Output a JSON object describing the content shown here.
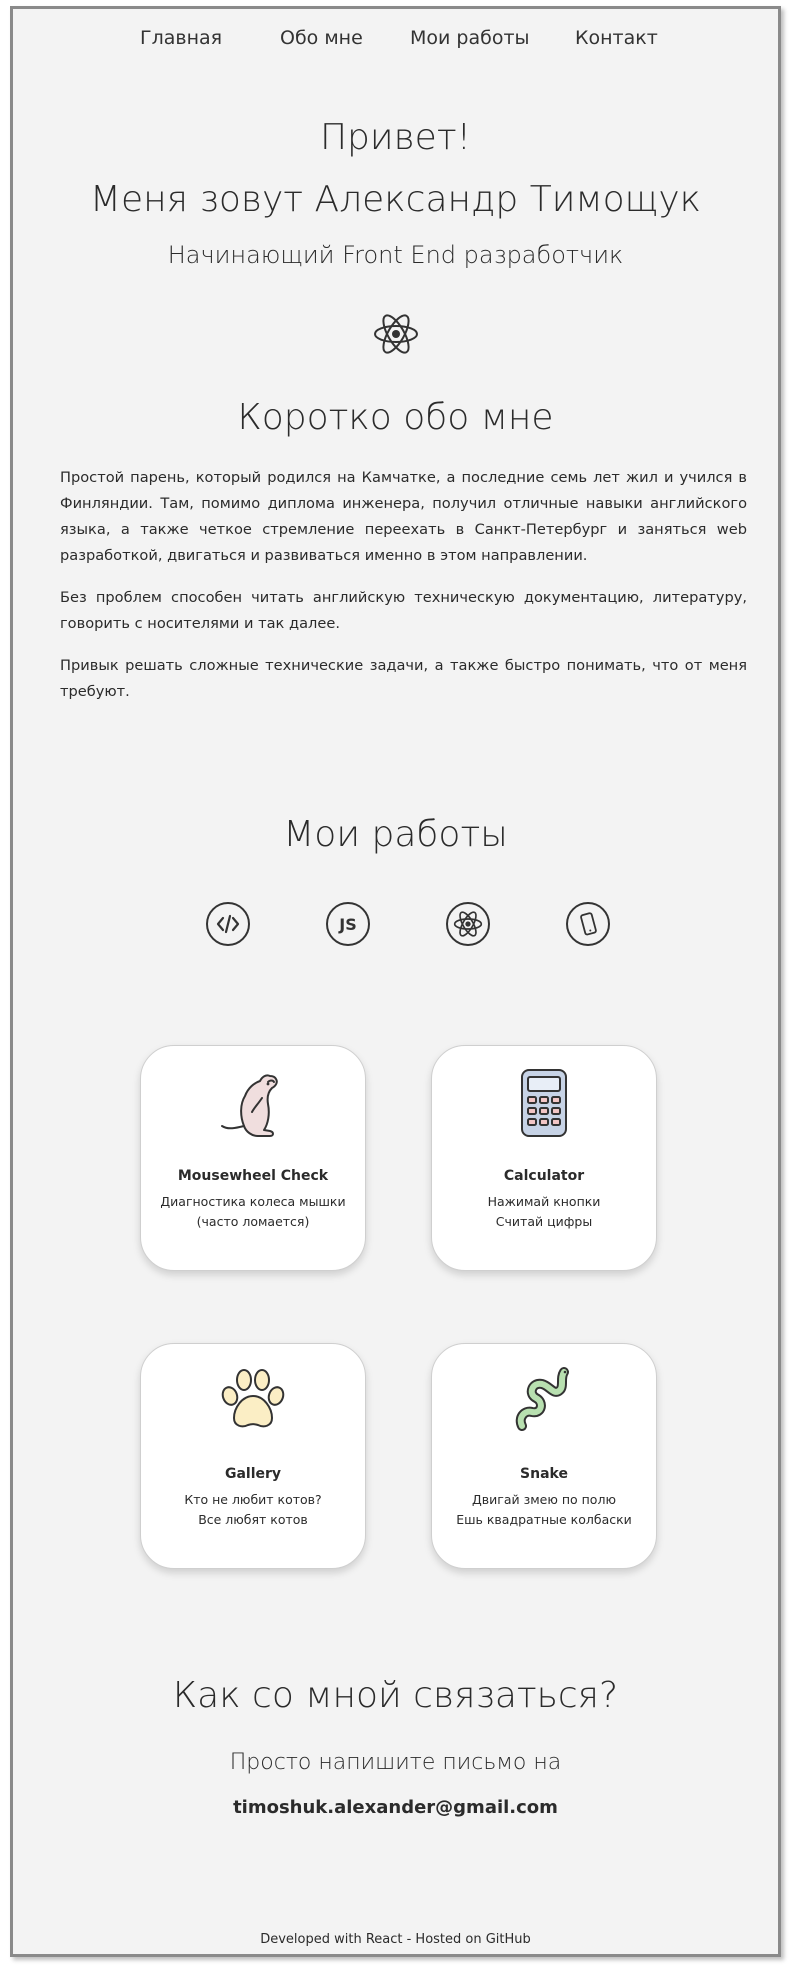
{
  "nav": {
    "home": "Главная",
    "about": "Обо мне",
    "works": "Мои работы",
    "contact": "Контакт"
  },
  "hero": {
    "greeting": "Привет!",
    "name": "Меня зовут Александр Тимощук",
    "subtitle": "Начинающий Front End разработчик",
    "icon": "react-atom-icon"
  },
  "about": {
    "title": "Коротко обо мне",
    "paragraphs": [
      "Простой парень, который родился на Камчатке, а последние семь лет жил и учился в Финляндии. Там, помимо диплома инженера, получил отличные навыки английского языка, а также четкое стремление переехать в Санкт-Петербург и заняться web разработкой, двигаться и развиваться именно в этом направлении.",
      "Без проблем способен читать английскую техническую документацию, литературу, говорить с носителями и так далее.",
      "Привык решать сложные технические задачи, а также быстро понимать, что от меня требуют."
    ]
  },
  "works": {
    "title": "Мои работы",
    "tech_icons": [
      "html-code-icon",
      "js-icon",
      "react-atom-icon",
      "mobile-phone-icon"
    ],
    "projects": [
      {
        "title": "Mousewheel Check",
        "desc_line1": "Диагностика колеса мышки",
        "desc_line2": "(часто ломается)",
        "icon": "mouse-icon"
      },
      {
        "title": "Calculator",
        "desc_line1": "Нажимай кнопки",
        "desc_line2": "Считай цифры",
        "icon": "calculator-icon"
      },
      {
        "title": "Gallery",
        "desc_line1": "Кто не любит котов?",
        "desc_line2": "Все любят котов",
        "icon": "paw-icon"
      },
      {
        "title": "Snake",
        "desc_line1": "Двигай змею по полю",
        "desc_line2": "Ешь квадратные колбаски",
        "icon": "snake-icon"
      }
    ]
  },
  "contact": {
    "title": "Как со мной связаться?",
    "text": "Просто напишите письмо на",
    "email": "timoshuk.alexander@gmail.com"
  },
  "footer": {
    "text": "Developed with React - Hosted on GitHub"
  },
  "colors": {
    "background": "#f3f3f3",
    "card": "#ffffff",
    "text": "#2b2b2b",
    "mouse_fill": "#f0dede",
    "paw_fill": "#fbeec5",
    "snake_fill": "#b8e0b0",
    "calculator_fill": "#c7d3e6"
  }
}
